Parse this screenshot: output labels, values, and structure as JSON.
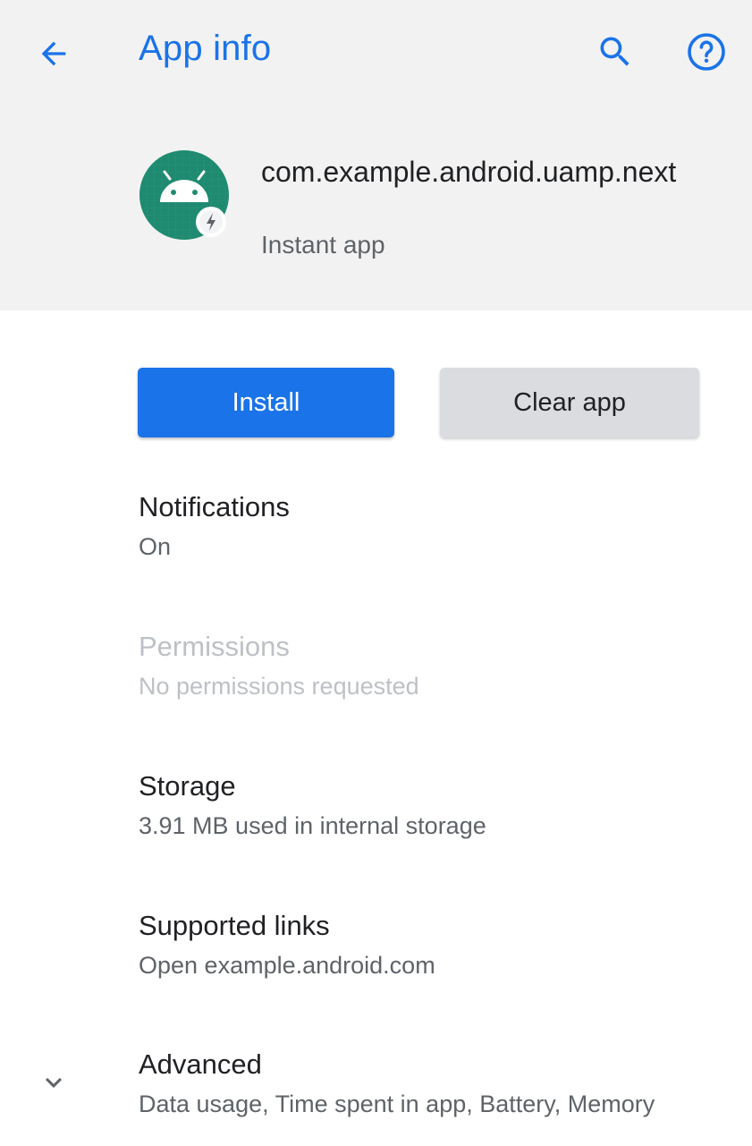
{
  "toolbar": {
    "title": "App info",
    "back_icon": "arrow-back-icon",
    "search_icon": "search-icon",
    "help_icon": "help-icon"
  },
  "app": {
    "name": "com.example.android.uamp.next",
    "type": "Instant app",
    "icon": "android-instant-app-icon"
  },
  "buttons": {
    "install": "Install",
    "clear": "Clear app"
  },
  "settings": {
    "notifications": {
      "title": "Notifications",
      "subtitle": "On"
    },
    "permissions": {
      "title": "Permissions",
      "subtitle": "No permissions requested"
    },
    "storage": {
      "title": "Storage",
      "subtitle": "3.91 MB used in internal storage"
    },
    "supported_links": {
      "title": "Supported links",
      "subtitle": "Open example.android.com"
    },
    "advanced": {
      "title": "Advanced",
      "subtitle": "Data usage, Time spent in app, Battery, Memory"
    }
  },
  "colors": {
    "accent": "#1a73e8",
    "header_bg": "#f2f2f2",
    "icon_bg": "#1f8a70"
  }
}
